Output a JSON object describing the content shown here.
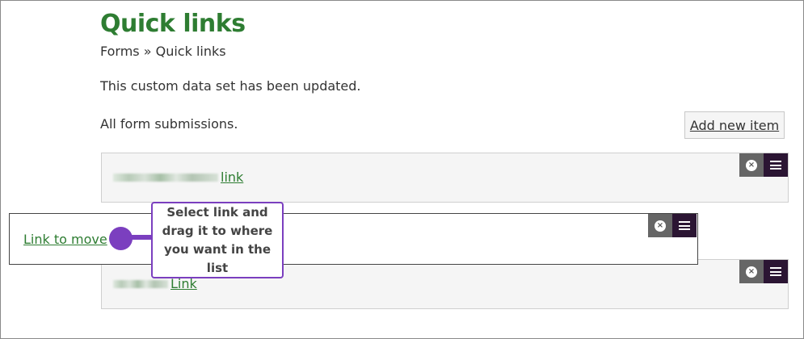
{
  "page": {
    "title": "Quick links",
    "breadcrumb": {
      "parent": "Forms",
      "separator": " » ",
      "current": "Quick links"
    },
    "status_message": "This custom data set has been updated.",
    "section_label": "All form submissions.",
    "add_button_label": "Add new item"
  },
  "items": [
    {
      "link_label": "link"
    },
    {
      "link_label": "Link to move"
    },
    {
      "link_label": "Link"
    }
  ],
  "controls": {
    "remove_icon": "x-circle-icon",
    "menu_icon": "hamburger-menu-icon",
    "remove_glyph": "×"
  },
  "callout": {
    "text": "Select link and drag it to where you want in the list"
  },
  "colors": {
    "title_green": "#2e7d32",
    "accent_purple": "#7b3fbf",
    "menu_dark": "#2b1533",
    "remove_grey": "#666666"
  }
}
